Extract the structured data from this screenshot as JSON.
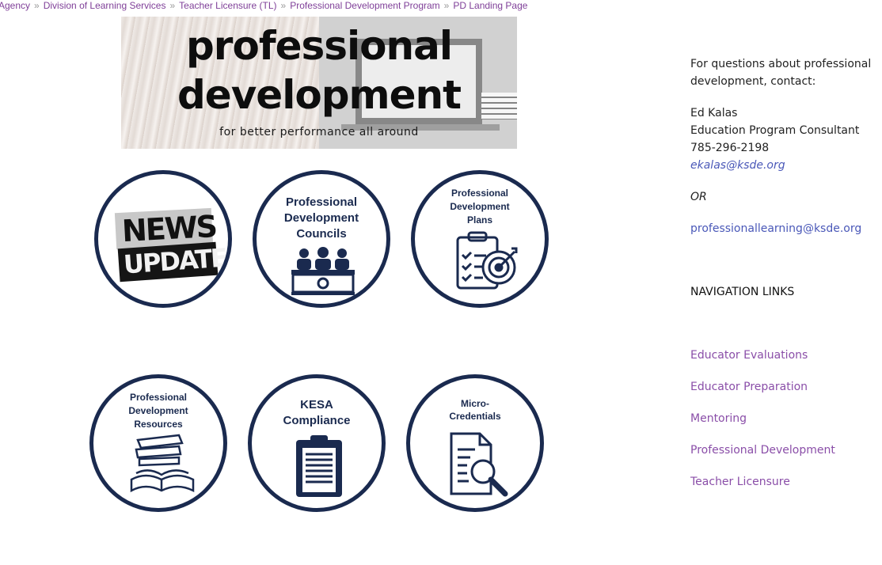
{
  "breadcrumb": [
    {
      "label": "Agency"
    },
    {
      "label": "Division of Learning Services"
    },
    {
      "label": "Teacher Licensure (TL)"
    },
    {
      "label": "Professional Development Program"
    },
    {
      "label": "PD Landing Page"
    }
  ],
  "breadcrumb_separator": "»",
  "banner": {
    "line1": "professional",
    "line2": "development",
    "tagline": "for better performance all around"
  },
  "tiles": {
    "news": {
      "word1": "NEWS",
      "word2": "UPDATE"
    },
    "councils": {
      "title_line1": "Professional",
      "title_line2": "Development",
      "title_line3": "Councils"
    },
    "plans": {
      "title_line1": "Professional",
      "title_line2": "Development",
      "title_line3": "Plans"
    },
    "resources": {
      "title_line1": "Professional",
      "title_line2": "Development",
      "title_line3": "Resources"
    },
    "kesa": {
      "title_line1": "KESA",
      "title_line2": "Compliance"
    },
    "micro": {
      "title_line1": "Micro-",
      "title_line2": "Credentials"
    }
  },
  "contact": {
    "intro_line1": "For questions about professional",
    "intro_line2": "development, contact:",
    "name": "Ed Kalas",
    "role": "Education Program Consultant",
    "phone": "785-296-2198",
    "email": "ekalas@ksde.org",
    "or": "OR",
    "alt_email": "professionallearning@ksde.org"
  },
  "nav": {
    "heading": "NAVIGATION LINKS",
    "links": [
      {
        "label": "Educator Evaluations"
      },
      {
        "label": "Educator Preparation"
      },
      {
        "label": "Mentoring"
      },
      {
        "label": "Professional Development"
      },
      {
        "label": "Teacher Licensure"
      }
    ]
  },
  "colors": {
    "link_purple": "#7f3f98",
    "circle_navy": "#1a2a4f",
    "email_blue": "#4a58b8",
    "nav_purple": "#8a4ea8"
  }
}
